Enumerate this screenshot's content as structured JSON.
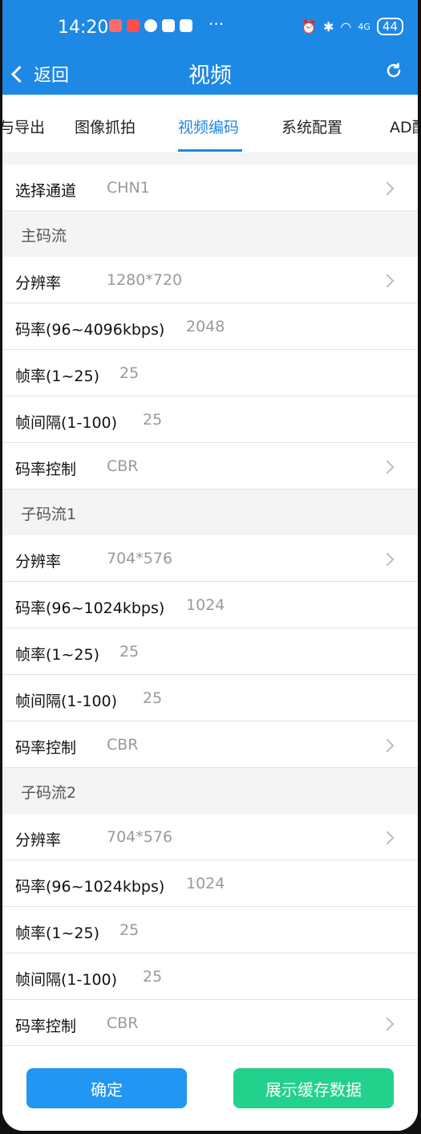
{
  "status_bar": {
    "time": "14:20",
    "network": "4G",
    "battery": "44"
  },
  "nav": {
    "back_label": "返回",
    "title": "视频"
  },
  "tabs": [
    "与导出",
    "图像抓拍",
    "视频编码",
    "系统配置",
    "AD配"
  ],
  "channel": {
    "label": "选择通道",
    "value": "CHN1"
  },
  "main_stream": {
    "section_title": "主码流",
    "resolution": {
      "label": "分辨率",
      "value": "1280*720"
    },
    "bitrate": {
      "label": "码率(96~4096kbps)",
      "value": "2048"
    },
    "framerate": {
      "label": "帧率(1~25)",
      "value": "25"
    },
    "interval": {
      "label": "帧间隔(1-100)",
      "value": "25"
    },
    "control": {
      "label": "码率控制",
      "value": "CBR"
    }
  },
  "sub_stream1": {
    "section_title": "子码流1",
    "resolution": {
      "label": "分辨率",
      "value": "704*576"
    },
    "bitrate": {
      "label": "码率(96~1024kbps)",
      "value": "1024"
    },
    "framerate": {
      "label": "帧率(1~25)",
      "value": "25"
    },
    "interval": {
      "label": "帧间隔(1-100)",
      "value": "25"
    },
    "control": {
      "label": "码率控制",
      "value": "CBR"
    }
  },
  "sub_stream2": {
    "section_title": "子码流2",
    "resolution": {
      "label": "分辨率",
      "value": "704*576"
    },
    "bitrate": {
      "label": "码率(96~1024kbps)",
      "value": "1024"
    },
    "framerate": {
      "label": "帧率(1~25)",
      "value": "25"
    },
    "interval": {
      "label": "帧间隔(1-100)",
      "value": "25"
    },
    "control": {
      "label": "码率控制",
      "value": "CBR"
    }
  },
  "footer": {
    "confirm_label": "确定",
    "cache_label": "展示缓存数据"
  },
  "colors": {
    "primary": "#1e88e5",
    "accent_green": "#22d18b",
    "button_blue": "#2196f3"
  }
}
